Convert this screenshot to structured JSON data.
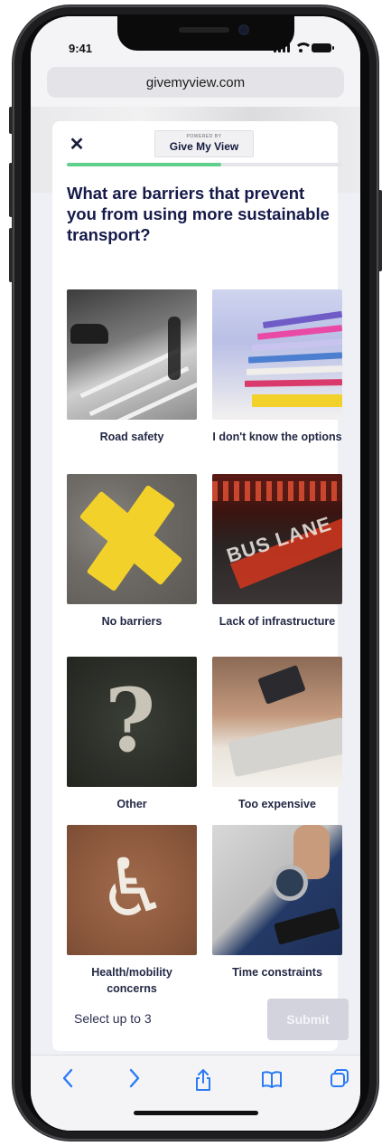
{
  "status_bar": {
    "time": "9:41"
  },
  "browser": {
    "url": "givemyview.com"
  },
  "survey": {
    "logo_powered": "POWERED BY",
    "logo_brand": "Give My View",
    "progress": 0.56,
    "question": "What are barriers that prevent you from using more sustainable transport?",
    "options": [
      {
        "label": "Road safety",
        "image": "road-crossing-photo"
      },
      {
        "label": "I don't know the options",
        "image": "stacked-papers-photo"
      },
      {
        "label": "No barriers",
        "image": "yellow-cross-photo"
      },
      {
        "label": "Lack of infrastructure",
        "image": "bus-lane-photo"
      },
      {
        "label": "Other",
        "image": "question-mark-photo"
      },
      {
        "label": "Too expensive",
        "image": "credit-card-laptop-photo"
      },
      {
        "label": "Health/mobility concerns",
        "image": "wheelchair-symbol-photo"
      },
      {
        "label": "Time constraints",
        "image": "wristwatch-photo"
      }
    ],
    "select_hint": "Select up to 3",
    "submit_label": "Submit"
  },
  "toolbar": {
    "back_icon": "chevron-left-icon",
    "forward_icon": "chevron-right-icon",
    "share_icon": "share-icon",
    "bookmarks_icon": "book-icon",
    "tabs_icon": "tabs-icon"
  },
  "colors": {
    "accent_green": "#5fd08a",
    "heading_navy": "#161a4a",
    "toolbar_blue": "#2a7bf6",
    "submit_disabled": "#d2d3dd"
  }
}
